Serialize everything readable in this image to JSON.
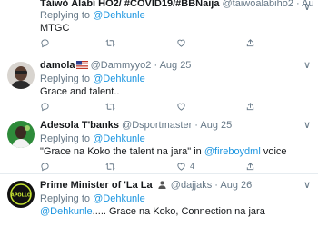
{
  "tweets": [
    {
      "name": "Táíwò Àlàbí HO2/ #COVID19/#BBNaija",
      "handle": "@taiwoalabiho2",
      "time": "Aug 25",
      "reply_prefix": "Replying to ",
      "reply_to": "@Dehkunle",
      "text": "MTGC"
    },
    {
      "name": "damola",
      "handle": "@Dammyyo2",
      "time": "Aug 25",
      "reply_prefix": "Replying to ",
      "reply_to": "@Dehkunle",
      "text": "Grace and talent.."
    },
    {
      "name": "Adesola T'banks",
      "handle": "@Dsportmaster",
      "time": "Aug 25",
      "reply_prefix": "Replying to ",
      "reply_to": "@Dehkunle",
      "text_quote": "\"Grace na Koko the talent na jara\" in ",
      "text_mention": "@fireboydml",
      "text_suffix": " voice",
      "like_count": "4"
    },
    {
      "name": "Prime Minister of 'La La",
      "handle": "@dajjaks",
      "time": "Aug 26",
      "reply_prefix": "Replying to ",
      "reply_to": "@Dehkunle",
      "text_mention": "@Dehkunle",
      "text_suffix": "..... Grace na Koko, Connection na jara",
      "avatar_text": "APOLLO"
    }
  ],
  "ui": {
    "dot": "·",
    "more": "∨"
  },
  "colors": {
    "link": "#1b95e0",
    "secondary": "#657786",
    "primary": "#14171a",
    "divider": "#e6ecf0"
  },
  "icons": [
    "reply-icon",
    "retweet-icon",
    "like-icon",
    "share-icon",
    "more-icon"
  ]
}
